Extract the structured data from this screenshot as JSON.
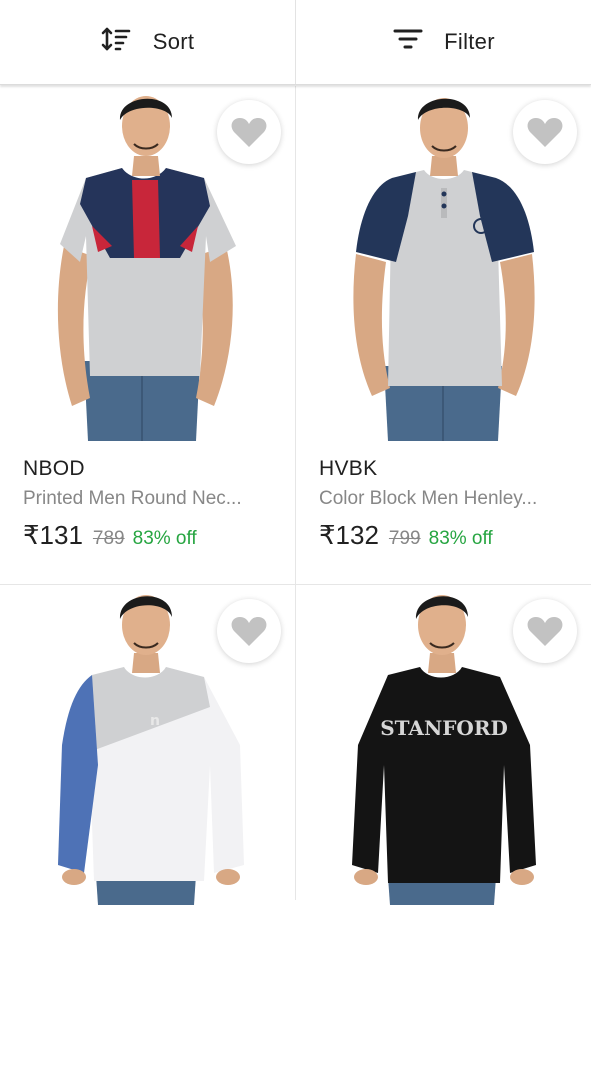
{
  "toolbar": {
    "sort_label": "Sort",
    "sort_icon": "sort-icon",
    "filter_label": "Filter",
    "filter_icon": "filter-icon"
  },
  "products": [
    {
      "brand": "NBOD",
      "title": "Printed Men Round Nec...",
      "price": "₹131",
      "mrp": "789",
      "discount": "83% off",
      "print_text": ""
    },
    {
      "brand": "HVBK",
      "title": "Color Block Men Henley...",
      "price": "₹132",
      "mrp": "799",
      "discount": "83% off",
      "print_text": ""
    },
    {
      "brand": "",
      "title": "",
      "price": "",
      "mrp": "",
      "discount": "",
      "print_text": ""
    },
    {
      "brand": "",
      "title": "",
      "price": "",
      "mrp": "",
      "discount": "",
      "print_text": "STANFORD"
    }
  ],
  "colors": {
    "discount_green": "#26a541",
    "muted_text": "#878787",
    "heart_grey": "#c2c2c2"
  },
  "icons": {
    "wishlist": "heart-icon"
  }
}
